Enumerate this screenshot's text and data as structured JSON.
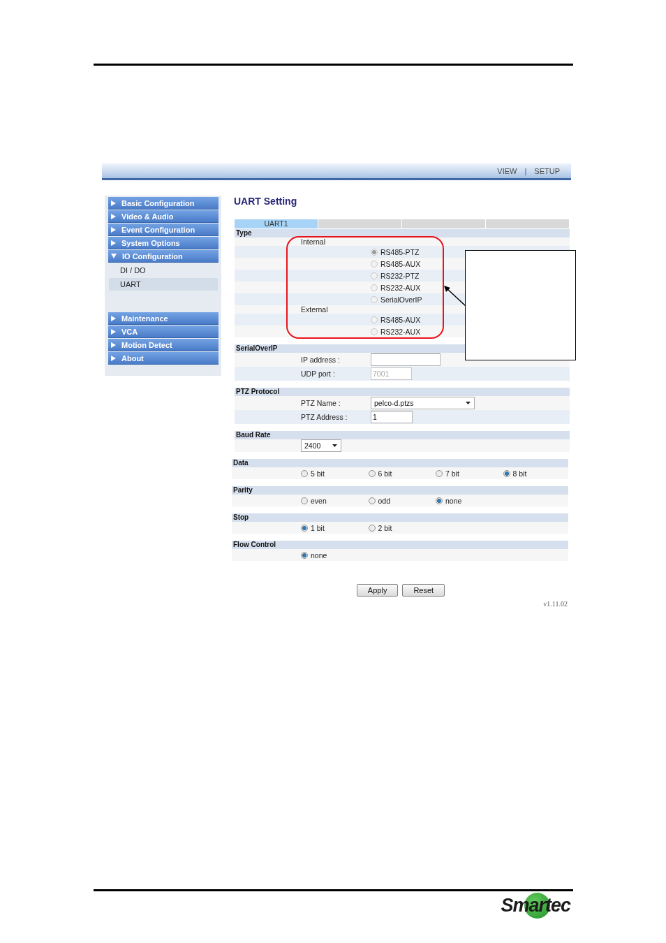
{
  "header": {
    "nav": [
      {
        "label": "VIEW"
      },
      {
        "label": "SETUP"
      }
    ],
    "separator": "|"
  },
  "sidebar": {
    "items": [
      {
        "label": "Basic Configuration",
        "expanded": false
      },
      {
        "label": "Video & Audio",
        "expanded": false
      },
      {
        "label": "Event Configuration",
        "expanded": false
      },
      {
        "label": "System Options",
        "expanded": false
      },
      {
        "label": "IO Configuration",
        "expanded": true,
        "children": [
          {
            "label": "DI / DO",
            "selected": false
          },
          {
            "label": "UART",
            "selected": true
          }
        ]
      },
      {
        "label": "Maintenance",
        "expanded": false
      },
      {
        "label": "VCA",
        "expanded": false
      },
      {
        "label": "Motion Detect",
        "expanded": false
      },
      {
        "label": "About",
        "expanded": false
      }
    ]
  },
  "main": {
    "title": "UART Setting",
    "tabs": [
      {
        "label": "UART1",
        "selected": true
      },
      {
        "selected": false
      },
      {
        "selected": false
      },
      {
        "selected": false
      }
    ],
    "sections": [
      {
        "title": "Type",
        "kind": "grouped_options",
        "groups": [
          {
            "label": "Internal",
            "options": [
              {
                "label": "RS485-PTZ",
                "selected": true,
                "disabled": true
              },
              {
                "label": "RS485-AUX",
                "selected": false,
                "disabled": true
              },
              {
                "label": "RS232-PTZ",
                "selected": false,
                "disabled": true
              },
              {
                "label": "RS232-AUX",
                "selected": false,
                "disabled": true
              },
              {
                "label": "SerialOverIP",
                "selected": false,
                "disabled": true
              }
            ]
          },
          {
            "label": "External",
            "options": [
              {
                "label": "RS485-AUX",
                "selected": false,
                "disabled": true
              },
              {
                "label": "RS232-AUX",
                "selected": false,
                "disabled": true
              }
            ]
          }
        ]
      },
      {
        "title": "SerialOverIP",
        "kind": "fields",
        "fields": [
          {
            "label": "IP address :",
            "kind": "input",
            "disabled": false
          },
          {
            "label": "UDP port :",
            "kind": "input",
            "value": "7001",
            "disabled": true
          }
        ]
      },
      {
        "title": "PTZ Protocol",
        "kind": "fields",
        "fields": [
          {
            "label": "PTZ Name :",
            "kind": "select",
            "value": "pelco-d.ptzs"
          },
          {
            "label": "PTZ Address :",
            "kind": "input",
            "value": "1",
            "disabled": false
          }
        ]
      },
      {
        "title": "Baud Rate",
        "kind": "fields",
        "fields": [
          {
            "kind": "select",
            "value": "2400"
          }
        ]
      },
      {
        "title": "Data",
        "kind": "options",
        "options": [
          {
            "label": "5 bit",
            "selected": false
          },
          {
            "label": "6 bit",
            "selected": false
          },
          {
            "label": "7 bit",
            "selected": false
          },
          {
            "label": "8 bit",
            "selected": true
          }
        ]
      },
      {
        "title": "Parity",
        "kind": "options",
        "options": [
          {
            "label": "even",
            "selected": false
          },
          {
            "label": "odd",
            "selected": false
          },
          {
            "label": "none",
            "selected": true
          }
        ]
      },
      {
        "title": "Stop",
        "kind": "options",
        "options": [
          {
            "label": "1 bit",
            "selected": true
          },
          {
            "label": "2 bit",
            "selected": false
          }
        ]
      },
      {
        "title": "Flow Control",
        "kind": "options",
        "options": [
          {
            "label": "none",
            "selected": true
          }
        ]
      }
    ],
    "buttons": [
      "Apply",
      "Reset"
    ],
    "version": "v1.11.02"
  },
  "footer": {
    "logo": "Smartec"
  }
}
